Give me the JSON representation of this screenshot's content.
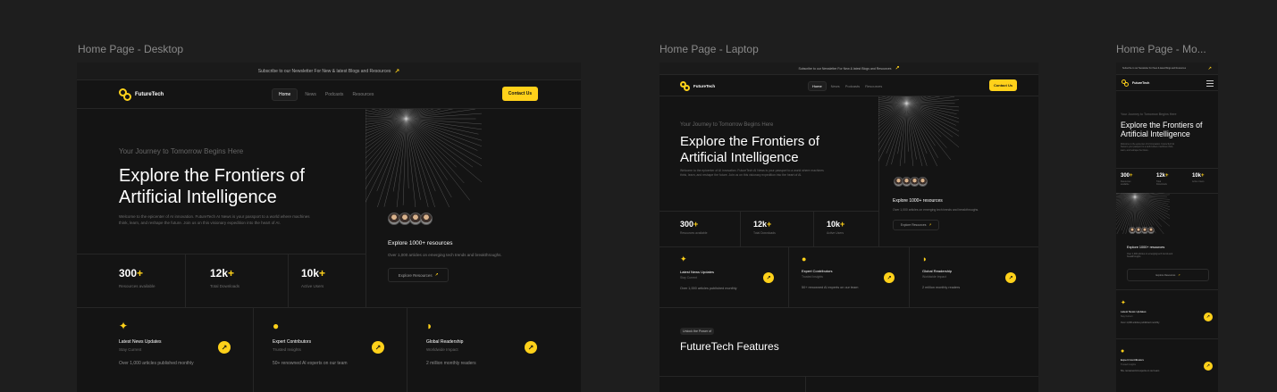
{
  "frames": {
    "desktop": {
      "label": "Home Page - Desktop"
    },
    "laptop": {
      "label": "Home Page - Laptop"
    },
    "mobile": {
      "label": "Home Page - Mo..."
    }
  },
  "banner": {
    "desktop": "Subscribe to our Newsletter For New & latest Blogs and Resources",
    "laptop": "Subscribe to our Newsletter For New & latest Blogs and Resources",
    "mobile": "Subscribe to our Newsletter For New & latest Blogs and Resources"
  },
  "logo": {
    "text": "FutureTech"
  },
  "nav": {
    "home": "Home",
    "news": "News",
    "podcasts": "Podcasts",
    "resources": "Resources",
    "contact": "Contact Us"
  },
  "hero": {
    "eyebrow": "Your Journey to Tomorrow Begins Here",
    "title_line1": "Explore the Frontiers of",
    "title_line2": "Artificial Intelligence",
    "desc_line1": "Welcome to the epicenter of AI innovation. FutureTech AI News is your passport to a world where machines",
    "desc_line2": "think, learn, and reshape the future. Join us on this visionary expedition into the heart of AI.",
    "mobile_desc_line1": "Welcome to the epicenter of AI innovation. FutureTech AI",
    "mobile_desc_line2": "News is your passport to a world where machines think,",
    "mobile_desc_line3": "learn, and reshape the future."
  },
  "explore": {
    "title": "Explore 1000+ resources",
    "desc": "Over 1,000 articles on emerging tech trends and breakthroughs.",
    "mobile_desc_line1": "Over 1,000 articles on emerging tech trends and",
    "mobile_desc_line2": "breakthroughs.",
    "button": "Explore Resources"
  },
  "stats": [
    {
      "value": "300",
      "plus": "+",
      "label": "Resources available",
      "mobile_label_line1": "Resources",
      "mobile_label_line2": "available"
    },
    {
      "value": "12k",
      "plus": "+",
      "label": "Total Downloads",
      "mobile_label_line1": "Total",
      "mobile_label_line2": "Downloads"
    },
    {
      "value": "10k",
      "plus": "+",
      "label": "Active Users",
      "mobile_label_line1": "Active Users",
      "mobile_label_line2": ""
    }
  ],
  "features": [
    {
      "icon": "sparkle-icon",
      "title": "Latest News Updates",
      "subtitle": "Stay Current",
      "desc": "Over 1,000 articles published monthly",
      "mobile_desc": "Over 1,000 articles published monthly"
    },
    {
      "icon": "contributors-icon",
      "title": "Expert Contributors",
      "subtitle": "Trusted Insights",
      "desc": "50+ renowned AI experts on our team",
      "mobile_desc": "50+ renowned AI experts on our team"
    },
    {
      "icon": "globe-leaf-icon",
      "title": "Global Readership",
      "subtitle": "Worldwide Impact",
      "desc": "2 million monthly readers"
    }
  ],
  "features_section": {
    "badge": "Unlock the Power of",
    "title": "FutureTech Features"
  },
  "colors": {
    "accent": "#ffd11a",
    "background": "#141414",
    "canvas": "#1e1e1e"
  }
}
